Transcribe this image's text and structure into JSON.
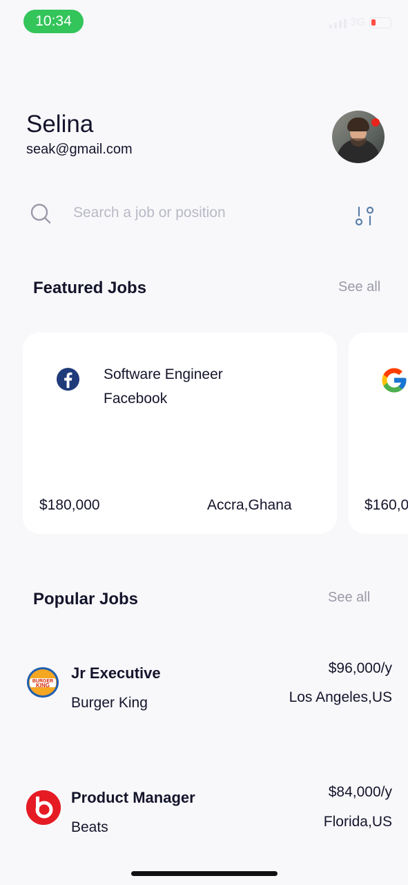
{
  "status_bar": {
    "time": "10:34",
    "network": "3G"
  },
  "profile": {
    "name": "Selina",
    "email": "seak@gmail.com"
  },
  "search": {
    "placeholder": "Search a job or position",
    "value": ""
  },
  "featured": {
    "title": "Featured Jobs",
    "see_all": "See all",
    "cards": [
      {
        "logo_icon": "facebook-icon",
        "title": "Software Engineer",
        "company": "Facebook",
        "salary": "$180,000",
        "location": "Accra,Ghana"
      },
      {
        "logo_icon": "google-icon",
        "salary": "$160,0"
      }
    ]
  },
  "popular": {
    "title": "Popular Jobs",
    "see_all": "See all",
    "jobs": [
      {
        "logo_icon": "burger-king-icon",
        "title": "Jr Executive",
        "company": "Burger King",
        "salary": "$96,000/y",
        "location": "Los Angeles,US"
      },
      {
        "logo_icon": "beats-icon",
        "title": "Product Manager",
        "company": "Beats",
        "salary": "$84,000/y",
        "location": "Florida,US"
      }
    ]
  },
  "colors": {
    "background": "#f8f8fb",
    "time_pill": "#33c45a",
    "notification_dot": "#e8241c",
    "facebook": "#1f3b7a",
    "beats": "#e51b24",
    "muted": "#9a9aa8"
  }
}
